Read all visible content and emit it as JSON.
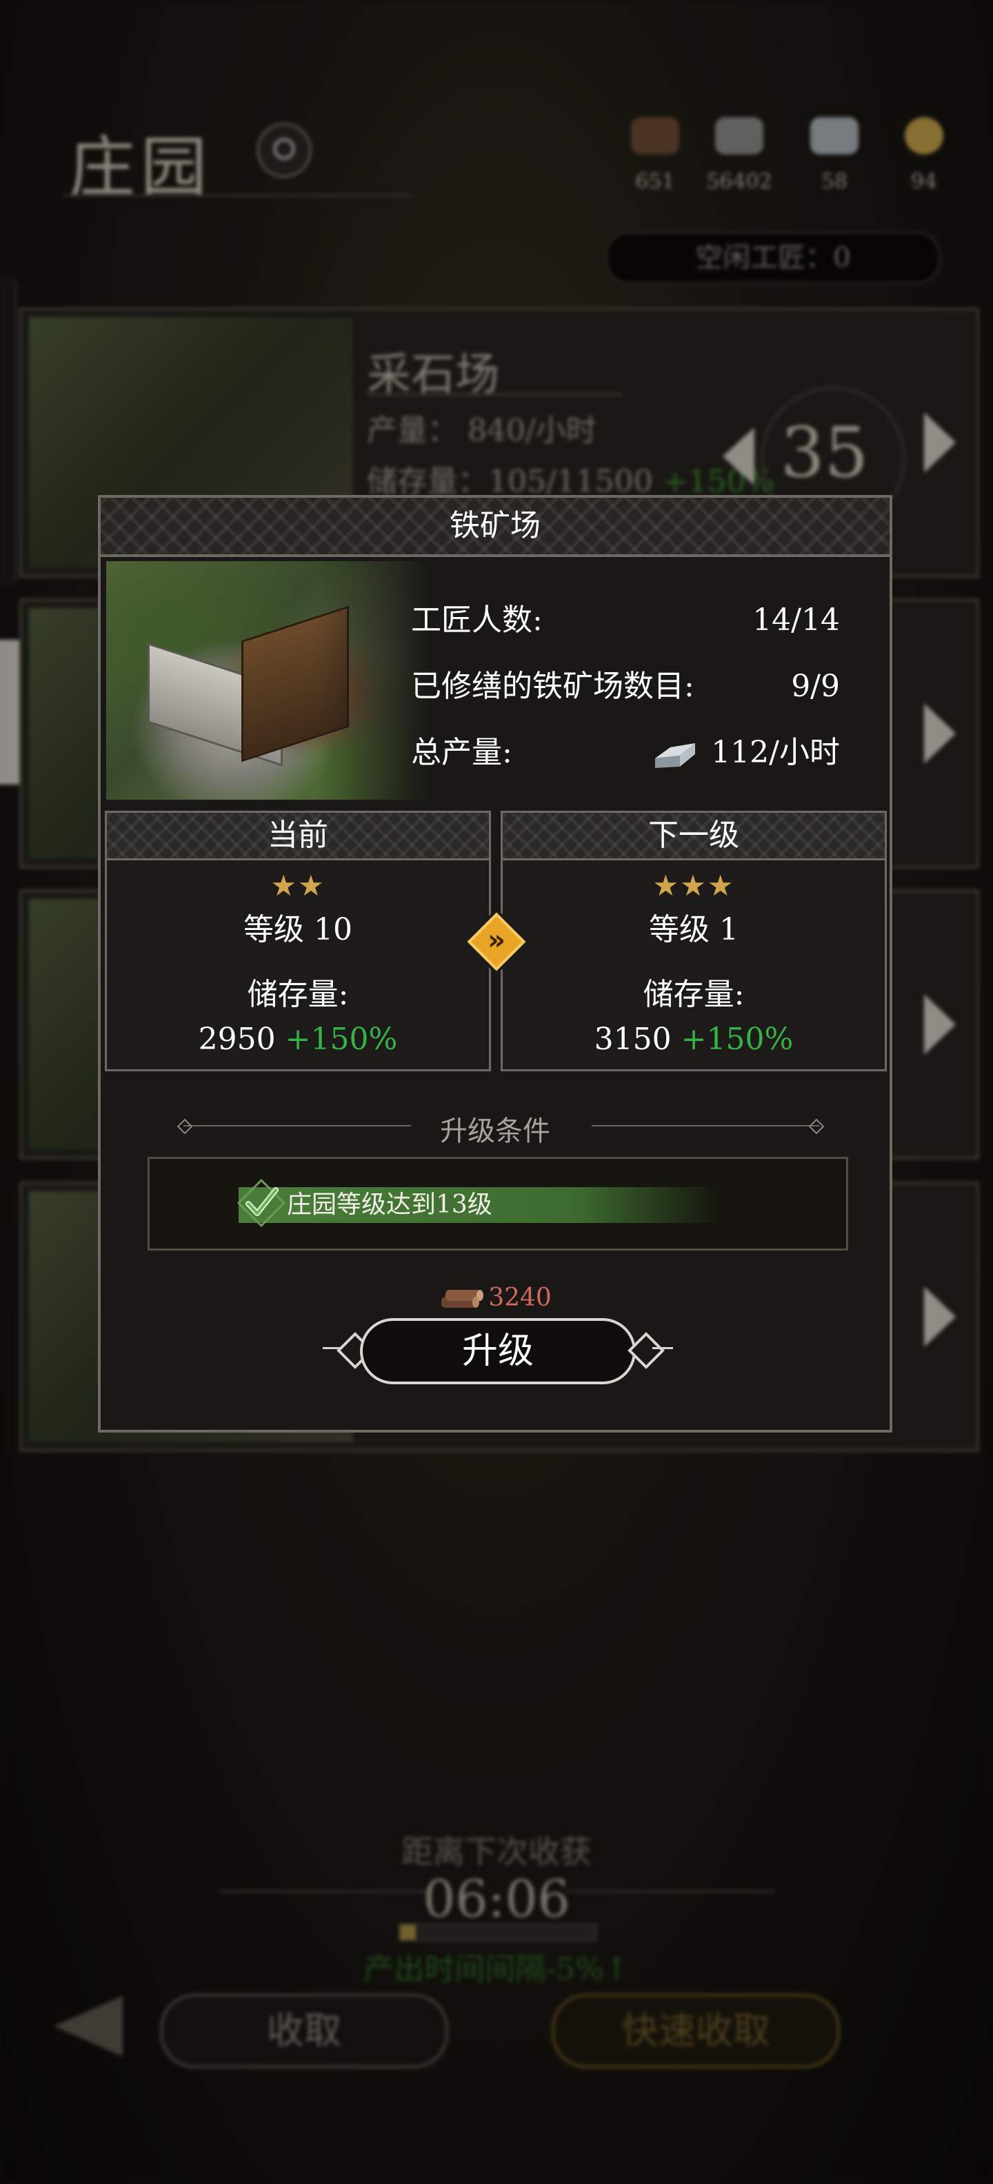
{
  "background": {
    "title": "庄园",
    "resources": [
      {
        "icon": "wood-icon",
        "amount": "651"
      },
      {
        "icon": "stone-icon",
        "amount": "56402"
      },
      {
        "icon": "iron-icon",
        "amount": "58"
      },
      {
        "icon": "gold-icon",
        "amount": "94"
      }
    ],
    "idle_workers": "空闲工匠：0",
    "building": {
      "name": "采石场",
      "production": "产量：  840/小时",
      "storage": "储存量：105/11500",
      "storage_bonus": "+150%",
      "level": "35"
    },
    "harvest": {
      "label": "距离下次收获",
      "timer": "06:06",
      "progress": 0.08,
      "bonus": "产出时间间隔-5%↑",
      "collect_label": "收取",
      "quick_collect_label": "快速收取"
    }
  },
  "dialog": {
    "title": "铁矿场",
    "workers_label": "工匠人数:",
    "workers_value": "14/14",
    "repaired_label": "已修缮的铁矿场数目:",
    "repaired_value": "9/9",
    "total_label": "总产量:",
    "total_value": "112/小时",
    "current": {
      "header": "当前",
      "stars": 2,
      "level": "等级 10",
      "storage_label": "储存量:",
      "storage_value": "2950",
      "storage_bonus": "+150%"
    },
    "next": {
      "header": "下一级",
      "stars": 3,
      "level": "等级 1",
      "storage_label": "储存量:",
      "storage_value": "3150",
      "storage_bonus": "+150%"
    },
    "conditions_title": "升级条件",
    "condition_text": "庄园等级达到13级",
    "cost": "3240",
    "upgrade_label": "升级"
  },
  "colors": {
    "bonus_green": "#36b345",
    "star_gold": "#d0a54c",
    "cost_red": "#d06a5e",
    "arrow_orange": "#e9a325"
  }
}
